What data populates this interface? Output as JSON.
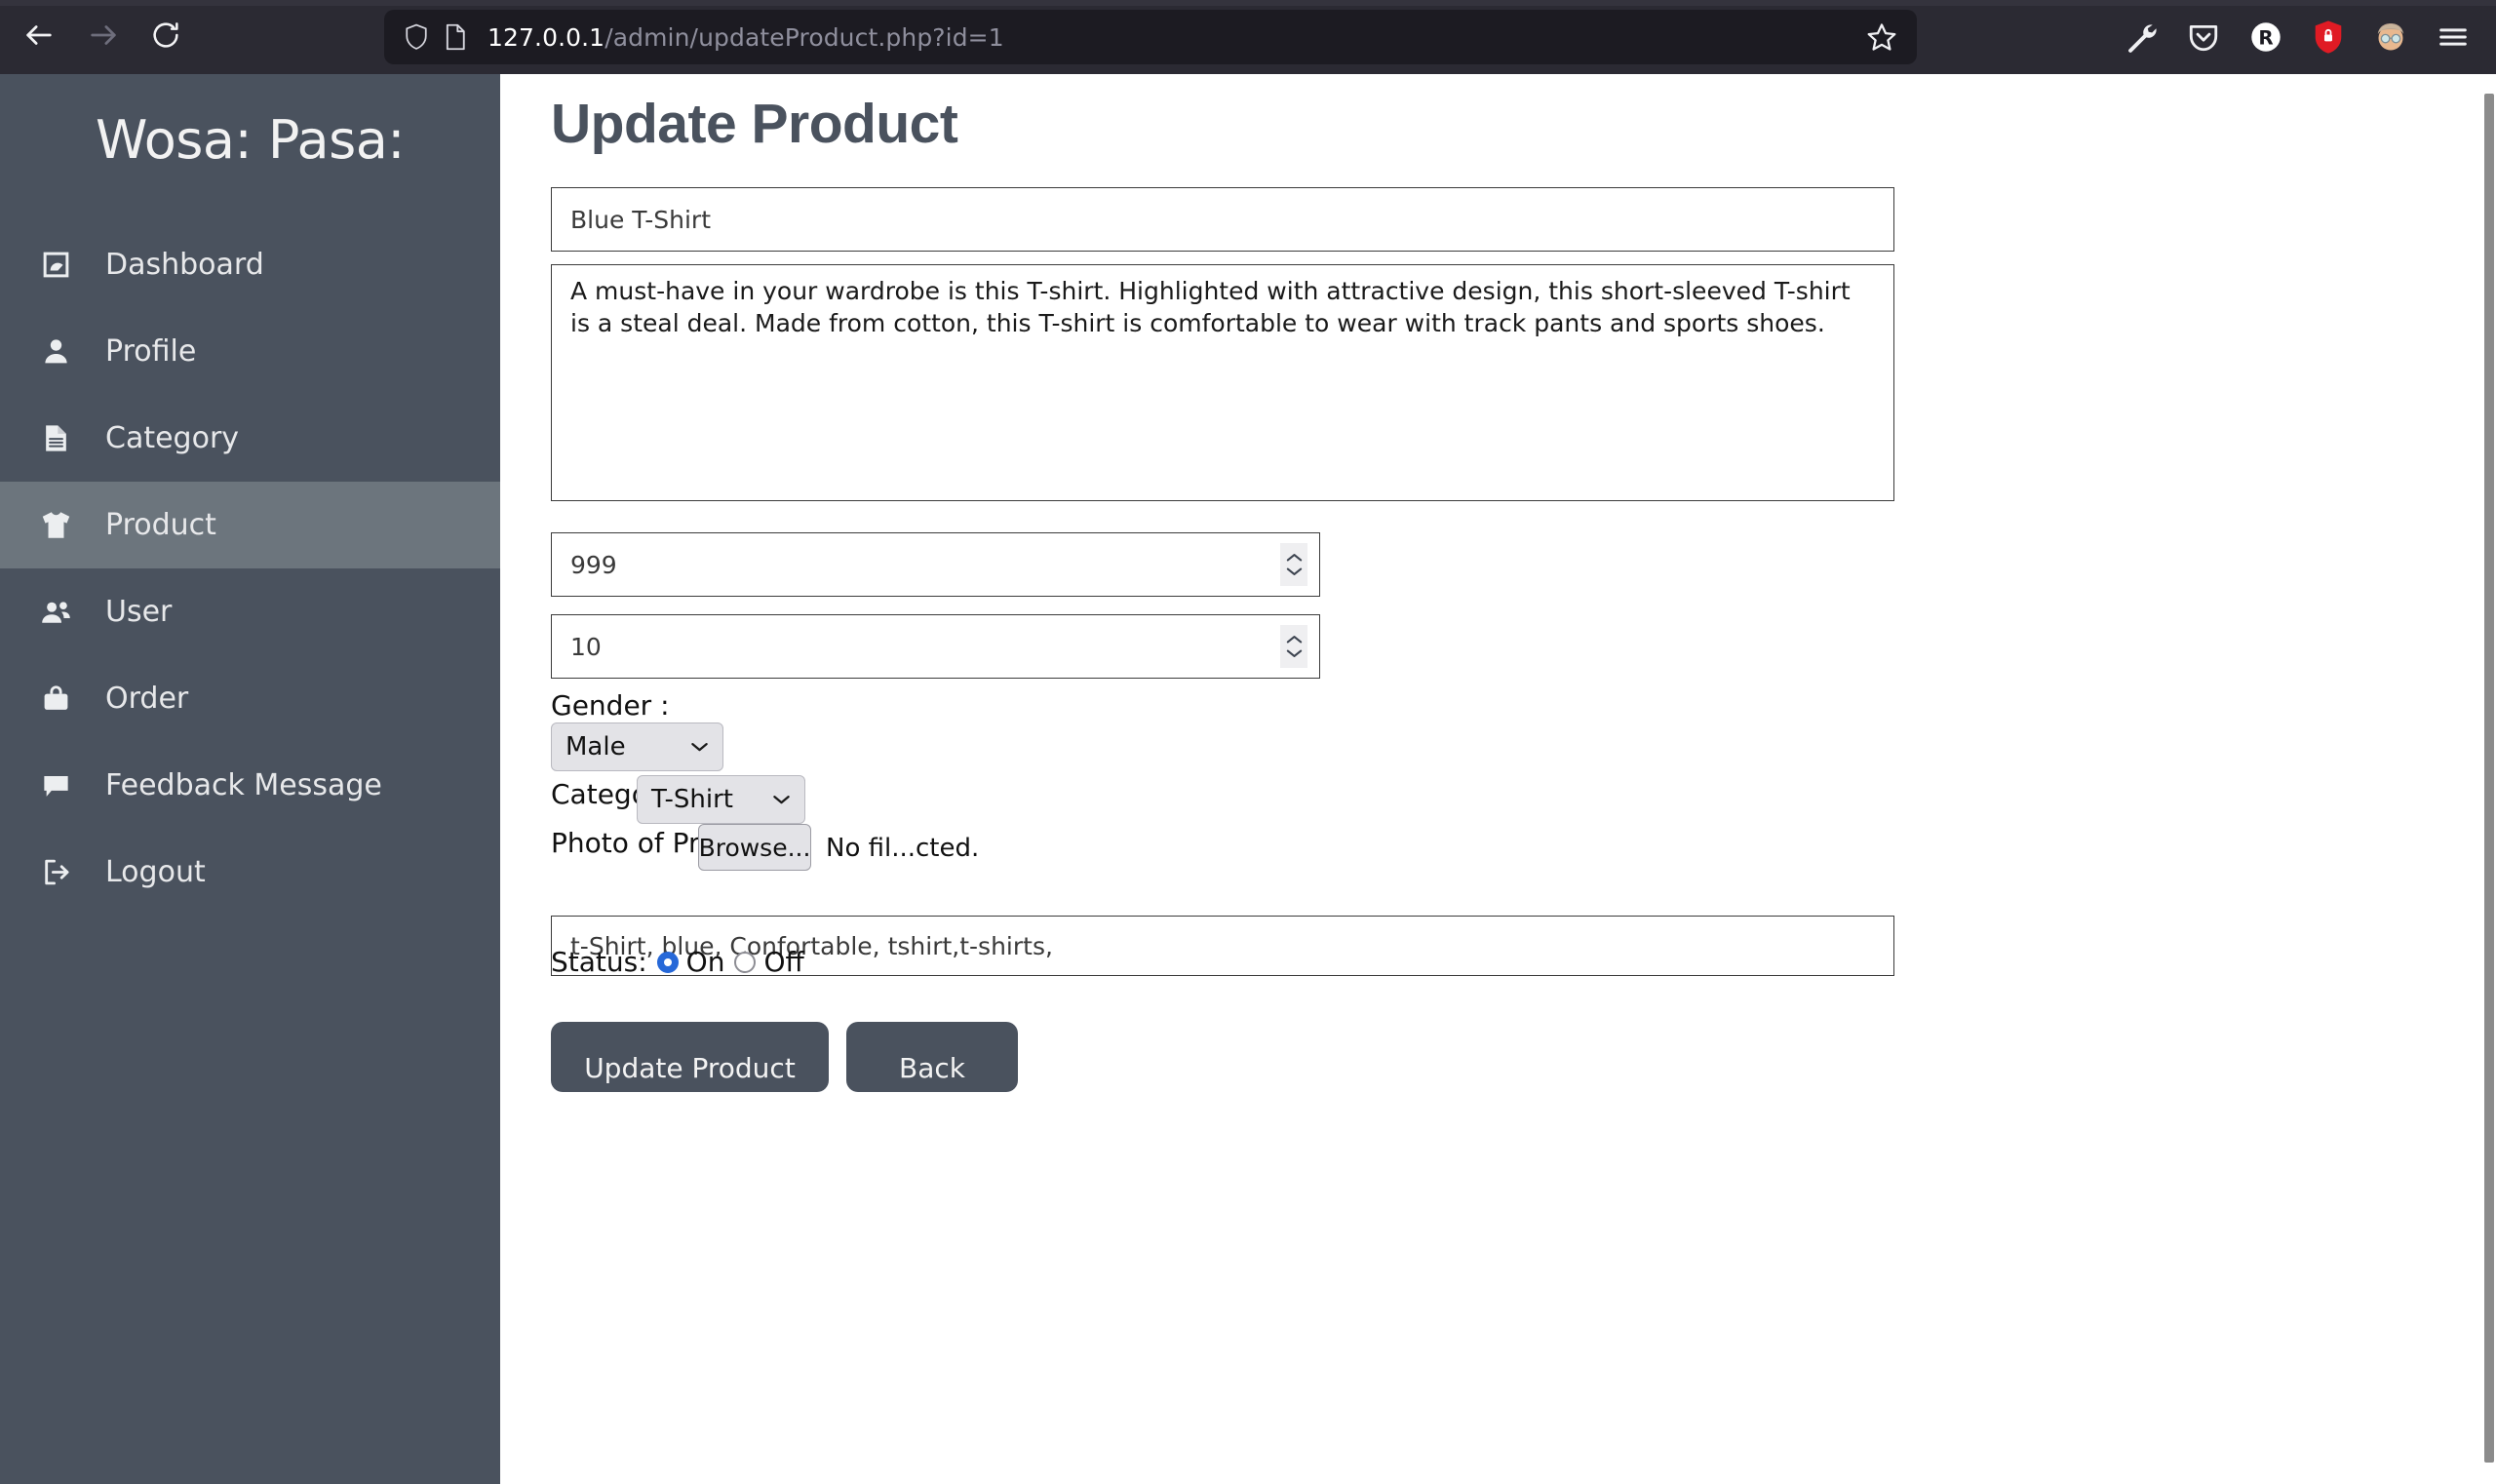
{
  "browser": {
    "nav": {
      "back": "back-arrow",
      "forward": "forward-arrow",
      "reload": "reload-arrow"
    },
    "url": {
      "host": "127.0.0.1",
      "path": "/admin/updateProduct.php?id=1",
      "shield_icon": "shield-icon",
      "page_icon": "page-icon",
      "bookmark_icon": "star-icon"
    },
    "toolbar_icons": [
      "wrench-icon",
      "pocket-icon",
      "rakuten-icon",
      "shield-lock-icon",
      "account-avatar-icon",
      "hamburger-menu-icon"
    ]
  },
  "sidebar": {
    "brand": "Wosa: Pasa:",
    "items": [
      {
        "label": "Dashboard",
        "icon": "dashboard-icon",
        "active": false
      },
      {
        "label": "Profile",
        "icon": "person-icon",
        "active": false
      },
      {
        "label": "Category",
        "icon": "document-icon",
        "active": false
      },
      {
        "label": "Product",
        "icon": "tshirt-icon",
        "active": true
      },
      {
        "label": "User",
        "icon": "users-icon",
        "active": false
      },
      {
        "label": "Order",
        "icon": "bag-icon",
        "active": false
      },
      {
        "label": "Feedback Message",
        "icon": "comment-icon",
        "active": false
      },
      {
        "label": "Logout",
        "icon": "logout-icon",
        "active": false
      }
    ]
  },
  "main": {
    "title": "Update Product",
    "product_name": "Blue T-Shirt",
    "product_description": "A must-have in your wardrobe is this T-shirt. Highlighted with attractive design, this short-sleeved T-shirt is a steal deal. Made from cotton, this T-shirt is comfortable to wear with track pants and sports shoes.",
    "quantity": "999",
    "price": "10",
    "gender_label": "Gender :",
    "gender_value": "Male",
    "category_label": "Category :",
    "category_value": "T-Shirt",
    "photo_label": "Photo of Product :",
    "browse_button": "Browse...",
    "no_file_text": "No fil...cted.",
    "tags": "t-Shirt, blue, Confortable, tshirt,t-shirts,",
    "status_label": "Status:",
    "status_on": "On",
    "status_off": "Off",
    "status_selected": "On",
    "update_button": "Update Product",
    "back_button": "Back"
  },
  "colors": {
    "sidebar_bg": "#4a525e",
    "sidebar_active": "#6c757d",
    "chrome_bg": "#2b2a33",
    "urlbar_bg": "#1c1b22",
    "radio_accent": "#2668d8",
    "button_bg": "#4a525e"
  }
}
